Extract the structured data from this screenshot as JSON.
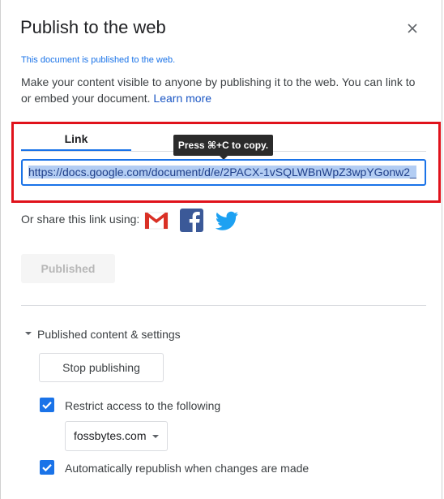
{
  "dialog": {
    "title": "Publish to the web",
    "status": "This document is published to the web.",
    "description": "Make your content visible to anyone by publishing it to the web. You can link to or embed your document.",
    "learn_more": "Learn more"
  },
  "tabs": {
    "link_label": "Link"
  },
  "tooltip": {
    "text": "Press ⌘+C to copy."
  },
  "link": {
    "value": "https://docs.google.com/document/d/e/2PACX-1vSQLWBnWpZ3wpYGonw2_"
  },
  "share": {
    "label": "Or share this link using:",
    "icons": [
      "gmail-icon",
      "facebook-icon",
      "twitter-icon"
    ]
  },
  "buttons": {
    "published": "Published",
    "stop_publishing": "Stop publishing"
  },
  "settings": {
    "section_label": "Published content & settings",
    "restrict_label": "Restrict access to the following",
    "restrict_checked": true,
    "domain_value": "fossbytes.com",
    "republish_label": "Automatically republish when changes are made",
    "republish_checked": true
  },
  "colors": {
    "accent": "#1a73e8",
    "highlight_box": "#e0121b",
    "gmail_red": "#d93025",
    "facebook_blue": "#3b5998",
    "twitter_blue": "#1da1f2"
  }
}
